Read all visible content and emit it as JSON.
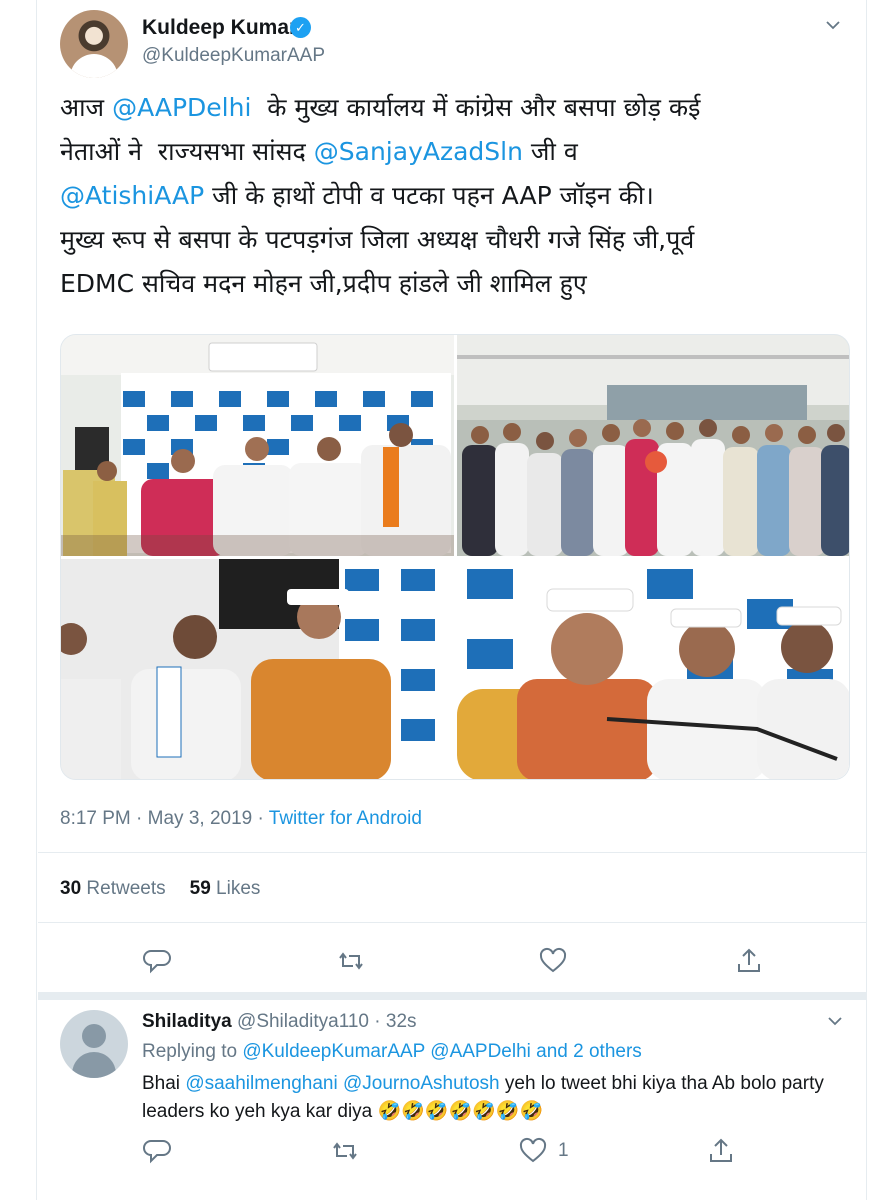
{
  "tweet": {
    "author_name": "Kuldeep Kumar",
    "verified_mark": "✓",
    "author_handle": "@KuldeepKumarAAP",
    "lines": [
      [
        {
          "t": "आज "
        },
        {
          "t": "@AAPDelhi",
          "m": true
        },
        {
          "t": "  के मुख्य कार्यालय में कांग्रेस और बसपा छोड़ कई"
        }
      ],
      [
        {
          "t": "नेताओं ने  राज्यसभा सांसद "
        },
        {
          "t": "@SanjayAzadSln",
          "m": true
        },
        {
          "t": " जी व"
        }
      ],
      [
        {
          "t": "@AtishiAAP",
          "m": true
        },
        {
          "t": " जी के हाथों टोपी व पटका पहन AAP जॉइन की।"
        }
      ],
      [
        {
          "t": "मुख्य रूप से बसपा के पटपड़गंज जिला अध्यक्ष चौधरी गजे सिंह जी,पूर्व"
        }
      ],
      [
        {
          "t": "EDMC सचिव मदन मोहन जी,प्रदीप हांडले जी शामिल हुए"
        }
      ]
    ],
    "time": "8:17 PM",
    "date": "May 3, 2019",
    "separator": " · ",
    "source": "Twitter for Android",
    "retweets_count": "30",
    "retweets_label": "Retweets",
    "likes_count": "59",
    "likes_label": "Likes",
    "photos": [
      "photo-group-hands-raised",
      "photo-group-outside-office",
      "photo-cap-placing",
      "photo-press-conference"
    ],
    "actions": [
      "reply-icon",
      "retweet-icon",
      "like-icon",
      "share-icon"
    ]
  },
  "reply": {
    "name": "Shiladitya",
    "handle_time": " @Shiladitya110 · 32s",
    "replying_to_label": "Replying to ",
    "replying_to_targets": "@KuldeepKumarAAP @AAPDelhi and 2 others",
    "text_parts": [
      {
        "t": "Bhai "
      },
      {
        "t": "@saahilmenghani",
        "m": true
      },
      {
        "t": " "
      },
      {
        "t": "@JournoAshutosh",
        "m": true
      },
      {
        "t": " yeh lo tweet bhi kiya tha Ab bolo party leaders ko yeh kya kar diya "
      },
      {
        "t": "🤣🤣🤣🤣🤣🤣🤣"
      }
    ],
    "likes_count": "1"
  },
  "colors": {
    "link": "#1b95e0",
    "muted": "#657786",
    "text": "#14171a",
    "divider": "#e6ecf0",
    "verified": "#1da1f2",
    "aap_blue": "#1e6fb8"
  }
}
